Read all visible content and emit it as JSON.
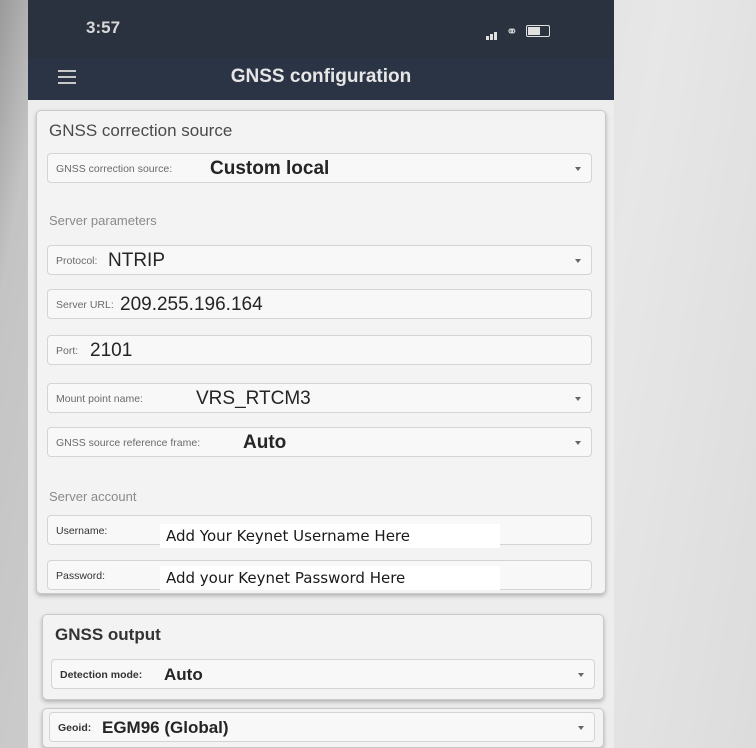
{
  "status_bar": {
    "time": "3:57"
  },
  "app_bar": {
    "title": "GNSS configuration"
  },
  "correction_card": {
    "title": "GNSS correction source",
    "source": {
      "label": "GNSS correction source:",
      "value": "Custom local"
    },
    "server_section": "Server parameters",
    "protocol": {
      "label": "Protocol:",
      "value": "NTRIP"
    },
    "server_url": {
      "label": "Server URL:",
      "value": "209.255.196.164"
    },
    "port": {
      "label": "Port:",
      "value": "2101"
    },
    "mount_point": {
      "label": "Mount point name:",
      "value": "VRS_RTCM3"
    },
    "reference_frame": {
      "label": "GNSS source reference frame:",
      "value": "Auto"
    },
    "account_section": "Server account",
    "username": {
      "label": "Username:",
      "value": "Add Your Keynet Username Here"
    },
    "password": {
      "label": "Password:",
      "value": "Add your Keynet Password Here"
    }
  },
  "output_card": {
    "title": "GNSS output",
    "detection_mode": {
      "label": "Detection mode:",
      "value": "Auto"
    },
    "geoid": {
      "label": "Geoid:",
      "value": "EGM96 (Global)"
    }
  },
  "icons": {
    "menu": "hamburger-menu-icon",
    "dropdown": "chevron-down-icon",
    "signal": "signal-icon",
    "link": "link-icon",
    "battery": "battery-icon"
  },
  "colors": {
    "app_bar": "#2b3444",
    "card_background": "#f3f3f3",
    "overlay": "#ffffff"
  }
}
